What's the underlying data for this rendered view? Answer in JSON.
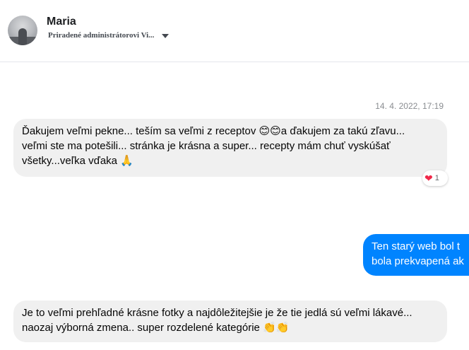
{
  "header": {
    "contact_name": "Maria",
    "assigned_to": "Priradené administrátorovi Vi..."
  },
  "conversation": {
    "timestamp": "14. 4. 2022, 17:19",
    "messages": [
      {
        "direction": "incoming",
        "lines": [
          "Ďakujem veľmi pekne... teším sa veľmi z receptov 😊😊a ďakujem za takú zľavu...",
          "veľmi ste ma potešili... stránka je krásna a super... recepty mám chuť vyskúšať",
          "všetky...veľka vďaka 🙏"
        ],
        "reaction": {
          "emoji": "❤",
          "count": "1"
        }
      },
      {
        "direction": "outgoing",
        "lines": [
          "Ten starý web bol t",
          "bola prekvapená ak"
        ]
      },
      {
        "direction": "incoming",
        "lines": [
          "Je to veľmi prehľadné krásne fotky a najdôležitejšie je že tie jedlá sú veľmi lákavé...",
          "naozaj výborná zmena.. super rozdelené kategórie 👏👏"
        ]
      }
    ]
  },
  "colors": {
    "incoming_bubble": "#f0f0f0",
    "outgoing_bubble": "#0084ff",
    "reaction_heart": "#f02849"
  },
  "icons": {
    "avatar": "profile-photo",
    "menu": "caret-down-icon",
    "reaction": "heart-icon"
  }
}
